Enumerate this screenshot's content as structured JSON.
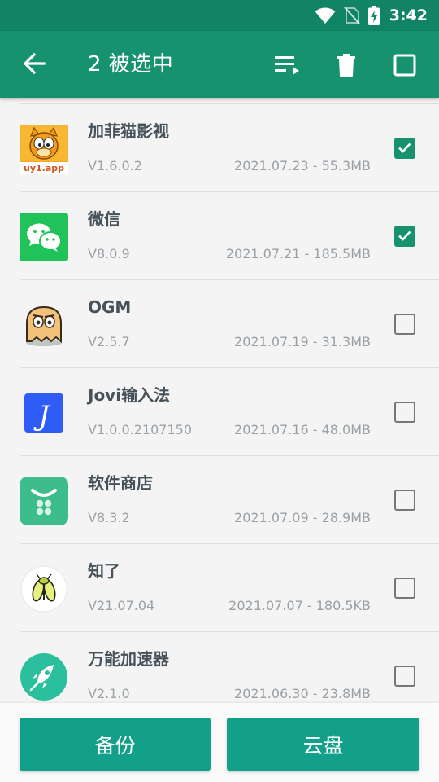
{
  "status": {
    "time": "3:42",
    "icons": [
      "wifi-icon",
      "no-sim-icon",
      "battery-charging-icon"
    ]
  },
  "appbar": {
    "title": "2 被选中",
    "back_icon": "arrow-back-icon",
    "actions": [
      "sort-icon",
      "delete-icon",
      "select-all-checkbox"
    ]
  },
  "colors": {
    "accent": "#17926f",
    "statusbar": "#128466",
    "button": "#13a08a"
  },
  "apps": [
    {
      "name": "加菲猫影视",
      "version": "V1.6.0.2",
      "meta": "2021.07.23 - 55.3MB",
      "checked": true,
      "icon_label": "uy1.app",
      "icon": "garfield-icon"
    },
    {
      "name": "微信",
      "version": "V8.0.9",
      "meta": "2021.07.21 - 185.5MB",
      "checked": true,
      "icon": "wechat-icon"
    },
    {
      "name": "OGM",
      "version": "V2.5.7",
      "meta": "2021.07.19 - 31.3MB",
      "checked": false,
      "icon": "ghost-icon"
    },
    {
      "name": "Jovi输入法",
      "version": "V1.0.0.2107150",
      "meta": "2021.07.16 - 48.0MB",
      "checked": false,
      "icon_label": "J",
      "icon": "jovi-icon"
    },
    {
      "name": "软件商店",
      "version": "V8.3.2",
      "meta": "2021.07.09 - 28.9MB",
      "checked": false,
      "icon": "store-icon"
    },
    {
      "name": "知了",
      "version": "V21.07.04",
      "meta": "2021.07.07 - 180.5KB",
      "checked": false,
      "icon": "cicada-icon"
    },
    {
      "name": "万能加速器",
      "version": "V2.1.0",
      "meta": "2021.06.30 - 23.8MB",
      "checked": false,
      "icon": "rocket-icon"
    }
  ],
  "bottom": {
    "backup_label": "备份",
    "cloud_label": "云盘"
  }
}
